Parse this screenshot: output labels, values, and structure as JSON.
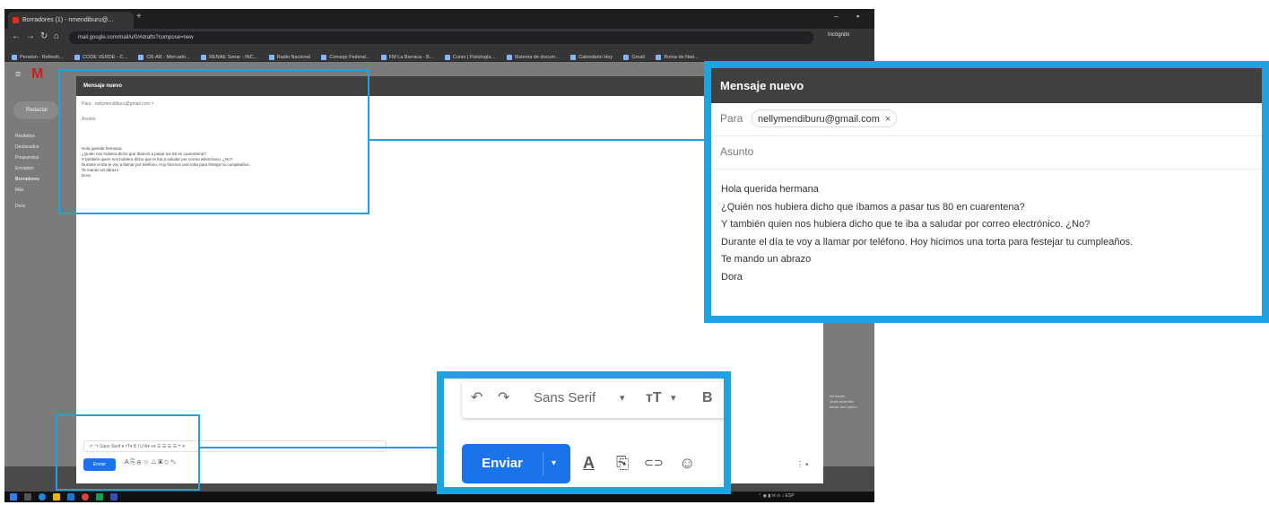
{
  "browser": {
    "tab_title": "Borradores (1) - nmendiburu@...",
    "new_tab": "+",
    "window_controls": [
      "–",
      "▪"
    ],
    "url": "mail.google.com/mail/u/0/#drafts?compose=new",
    "profile_label": "Incógnito",
    "bookmarks": [
      "Pension - Refresh...",
      "CODE VERDE - C...",
      "CR-AR - Mercado...",
      "RENAE Sonar - INC...",
      "Radio Nacional",
      "Consejo Federal...",
      "FM La Barraca - B...",
      "Curso | Fisiología...",
      "Sistema de docum...",
      "Calendario Hoy",
      "Gmail",
      "Roma de Nari..."
    ]
  },
  "gmail": {
    "logo": "M",
    "compose_label": "Redactar",
    "sidebar_items": [
      "Recibidos",
      "Destacados",
      "Pospuestos",
      "Enviados",
      "Borradores",
      "Más",
      "Dora"
    ],
    "right_panel_text": [
      "No tienes",
      "chats recientes",
      "Iniciar uno nuevo"
    ]
  },
  "compose_small": {
    "title": "Mensaje nuevo",
    "to_label": "Para",
    "to_chip": "nellymendiburu@gmail.com ×",
    "subject_label": "Asunto",
    "body_lines": [
      "Hola querida hermana",
      "¿Quién nos hubiera dicho que íbamos a pasar tus 80 en cuarentena?",
      "Y también quien nos hubiera dicho que te iba a saludar por correo electrónico. ¿No?",
      "Durante el día te voy a llamar por teléfono. Hoy hicimos una torta para festejar tu cumpleaños.",
      "Te mando un abrazo",
      "Dora"
    ],
    "format_bar": "↶  ↷  Sans Serif  ▾  ᴛT▾  B  I  U  A▾  ≡▾  ☰  ☰  ☰  ☰  ❝  ✕",
    "send_label": "Enviar",
    "send_icons": "A  ⎘  ⊕  ☺  △  ▣  ⊙  ✎",
    "more_icons": "⋮ ▪"
  },
  "zoom_message": {
    "title": "Mensaje nuevo",
    "to_label": "Para",
    "to_chip": "nellymendiburu@gmail.com",
    "chip_close": "×",
    "subject_label": "Asunto",
    "body_lines": [
      "Hola querida hermana",
      "¿Quién nos hubiera dicho que íbamos a pasar tus 80 en cuarentena?",
      "Y también quien nos hubiera dicho que te iba a saludar por correo electrónico. ¿No?",
      "Durante el día te voy a llamar por teléfono. Hoy hicimos una torta para festejar tu cumpleaños.",
      "Te mando un abrazo",
      "Dora"
    ]
  },
  "zoom_toolbar": {
    "undo": "↶",
    "redo": "↷",
    "font": "Sans Serif",
    "font_dropdown": "▾",
    "text_size": "ᴛT",
    "text_size_dropdown": "▾",
    "bold": "B",
    "send_label": "Enviar",
    "send_options": "▾",
    "text_color": "A",
    "attach": "⎘",
    "link": "⊂⊃",
    "emoji": "☺"
  },
  "colors": {
    "highlight": "#1ea3e0",
    "send_button": "#1a73e8",
    "dialog_header": "#404040"
  }
}
